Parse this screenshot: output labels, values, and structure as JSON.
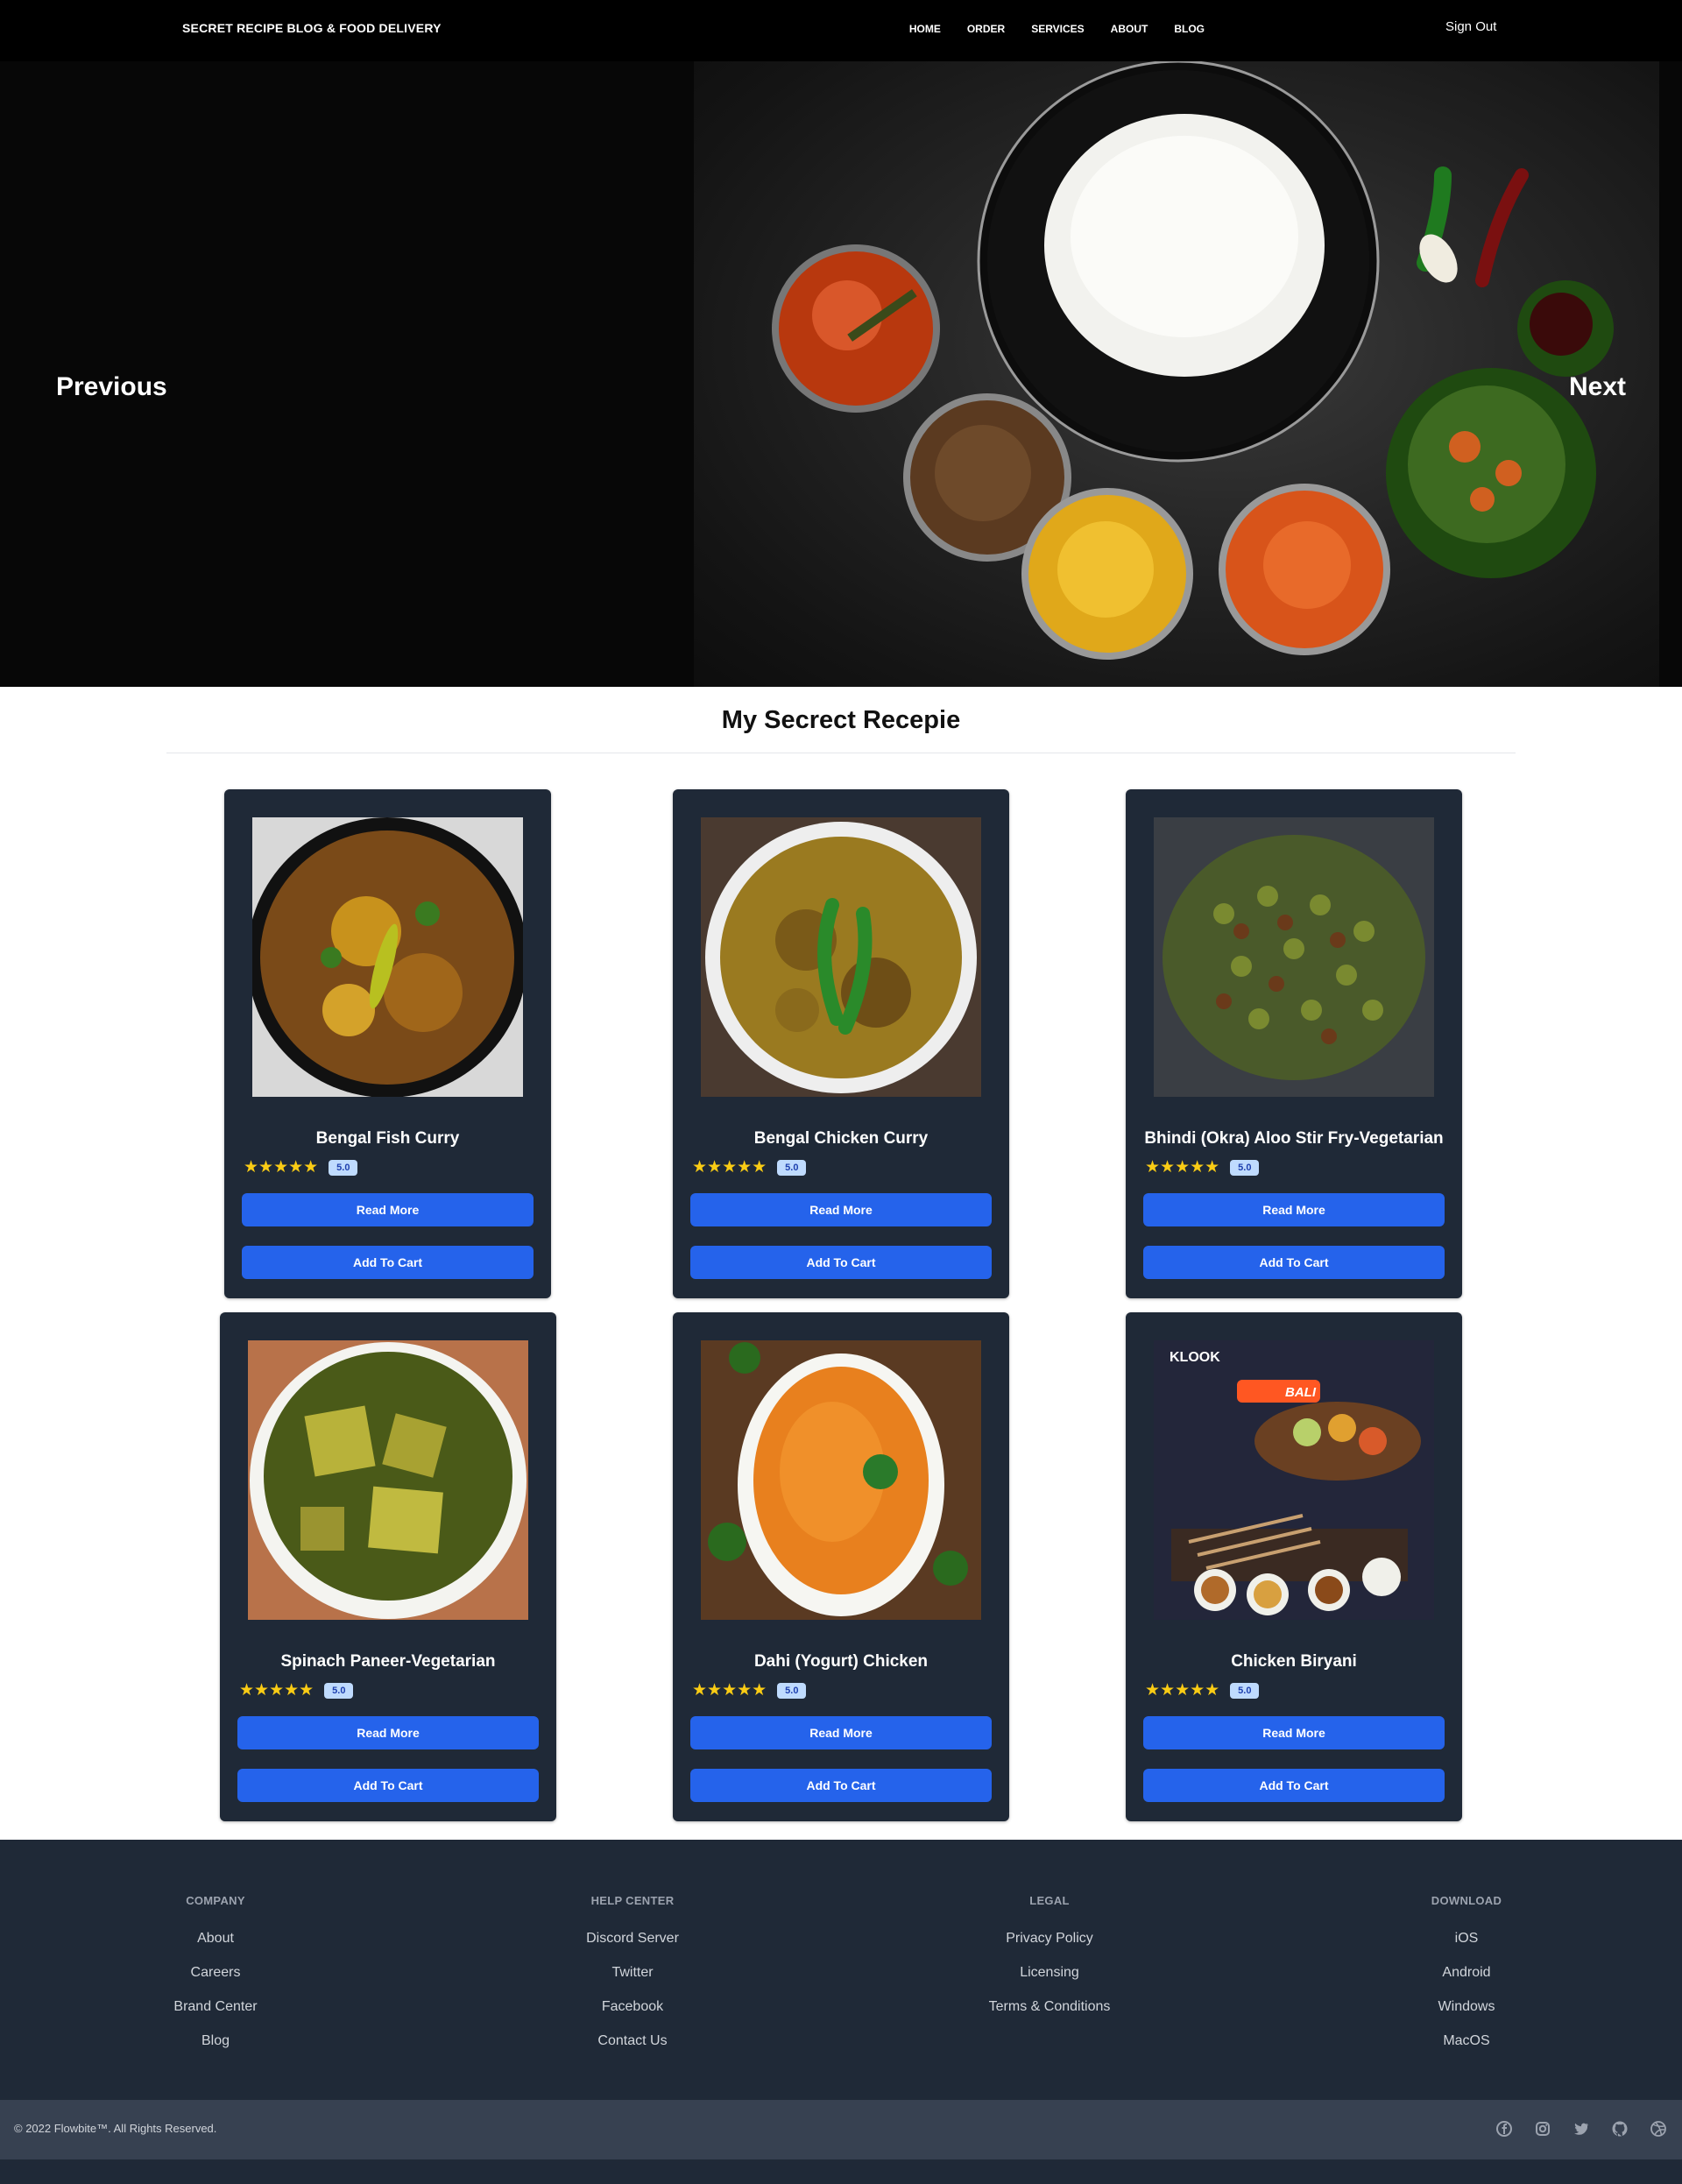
{
  "navbar": {
    "brand": "SECRET RECIPE BLOG & FOOD DELIVERY",
    "links": [
      "HOME",
      "ORDER",
      "SERVICES",
      "ABOUT",
      "BLOG"
    ],
    "sign_out": "Sign Out"
  },
  "hero": {
    "prev_label": "Previous",
    "next_label": "Next"
  },
  "section": {
    "title": "My Secrect Recepie"
  },
  "cards": [
    {
      "title": "Bengal Fish Curry",
      "rating": "5.0",
      "read_more": "Read More",
      "add_to_cart": "Add To Cart"
    },
    {
      "title": "Bengal Chicken Curry",
      "rating": "5.0",
      "read_more": "Read More",
      "add_to_cart": "Add To Cart"
    },
    {
      "title": "Bhindi (Okra) Aloo Stir Fry-Vegetarian",
      "rating": "5.0",
      "read_more": "Read More",
      "add_to_cart": "Add To Cart"
    },
    {
      "title": "Spinach Paneer-Vegetarian",
      "rating": "5.0",
      "read_more": "Read More",
      "add_to_cart": "Add To Cart"
    },
    {
      "title": "Dahi (Yogurt) Chicken",
      "rating": "5.0",
      "read_more": "Read More",
      "add_to_cart": "Add To Cart"
    },
    {
      "title": "Chicken Biryani",
      "rating": "5.0",
      "read_more": "Read More",
      "add_to_cart": "Add To Cart"
    }
  ],
  "stars": "★★★★★",
  "promo_image_text": {
    "brand": "KLOOK",
    "place": "BALI"
  },
  "footer": {
    "columns": [
      {
        "title": "COMPANY",
        "links": [
          "About",
          "Careers",
          "Brand Center",
          "Blog"
        ]
      },
      {
        "title": "HELP CENTER",
        "links": [
          "Discord Server",
          "Twitter",
          "Facebook",
          "Contact Us"
        ]
      },
      {
        "title": "LEGAL",
        "links": [
          "Privacy Policy",
          "Licensing",
          "Terms & Conditions"
        ]
      },
      {
        "title": "DOWNLOAD",
        "links": [
          "iOS",
          "Android",
          "Windows",
          "MacOS"
        ]
      }
    ],
    "copyright": "© 2022 Flowbite™. All Rights Reserved.",
    "social_icons": [
      "facebook-icon",
      "instagram-icon",
      "twitter-icon",
      "github-icon",
      "dribbble-icon"
    ]
  },
  "colors": {
    "navbar_bg": "#000000",
    "card_bg": "#1f2937",
    "button_bg": "#2563eb",
    "star": "#facc15",
    "footer_bg": "#1f2937",
    "bottom_bar_bg": "#374151"
  }
}
